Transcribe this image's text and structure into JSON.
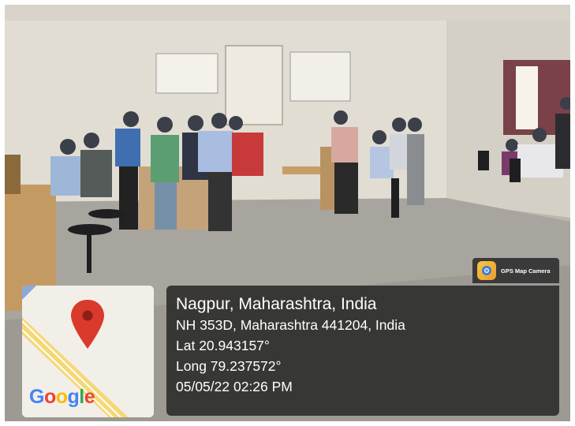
{
  "camera_badge": {
    "label": "GPS Map Camera"
  },
  "location": {
    "city_line": "Nagpur, Maharashtra, India",
    "address": "NH 353D, Maharashtra 441204, India",
    "latitude": "Lat 20.943157°",
    "longitude": "Long 79.237572°",
    "datetime": "05/05/22 02:26 PM"
  },
  "map": {
    "logo": [
      "G",
      "o",
      "o",
      "g",
      "l",
      "e"
    ],
    "pin_color": "#d93a2b",
    "road_color": "#f6d777"
  },
  "colors": {
    "panel_bg": "#262626",
    "wall": "#e4e0d6",
    "floor": "#a9a6a0"
  }
}
